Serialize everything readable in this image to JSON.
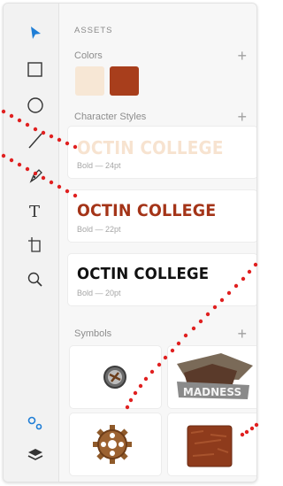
{
  "panel": {
    "header": "ASSETS",
    "colors_label": "Colors",
    "char_styles_label": "Character Styles",
    "symbols_label": "Symbols",
    "plus_glyph": "+"
  },
  "colors": [
    "#f7e7d5",
    "#a83e1c"
  ],
  "char_styles": [
    {
      "text": "OCTIN COLLEGE",
      "meta": "Bold — 24pt",
      "color": "#f7e3d0"
    },
    {
      "text": "OCTIN COLLEGE",
      "meta": "Bold — 22pt",
      "color": "#a43418"
    },
    {
      "text": "OCTIN COLLEGE",
      "meta": "Bold — 20pt",
      "color": "#111111"
    }
  ],
  "symbols": [
    {
      "name": "button-gear-icon"
    },
    {
      "name": "mad-madness-logo",
      "text": "MADNESS"
    },
    {
      "name": "rusty-gear-icon"
    },
    {
      "name": "rust-texture-tile"
    }
  ],
  "accent": "#1f7ed6"
}
